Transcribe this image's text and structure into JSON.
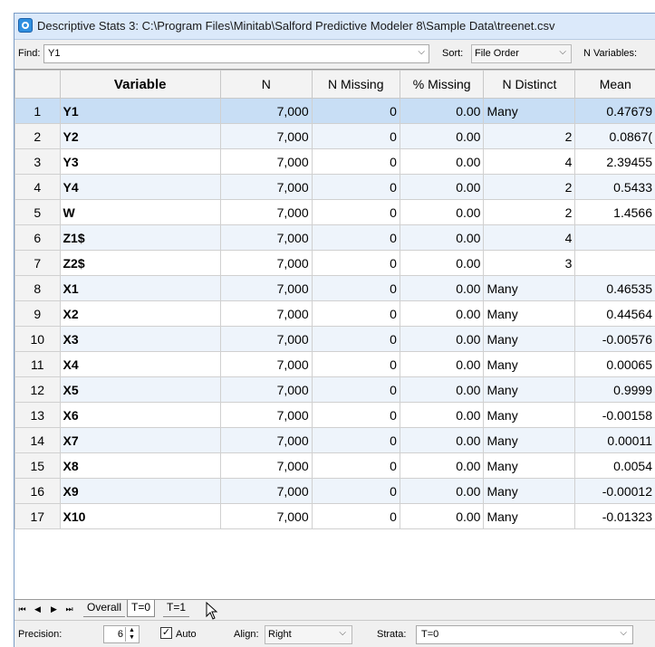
{
  "window": {
    "title": "Descriptive Stats 3: C:\\Program Files\\Minitab\\Salford Predictive Modeler 8\\Sample Data\\treenet.csv"
  },
  "toolbar": {
    "find_label": "Find:",
    "find_value": "Y1",
    "sort_label": "Sort:",
    "sort_value": "File Order",
    "nvars_label": "N Variables:"
  },
  "grid": {
    "columns": [
      "",
      "Variable",
      "N",
      "N Missing",
      "% Missing",
      "N Distinct",
      "Mean"
    ],
    "selected_row": 1,
    "rows": [
      {
        "num": "1",
        "var": "Y1",
        "n": "7,000",
        "nmiss": "0",
        "pmiss": "0.00",
        "ndist": "Many",
        "mean": "0.47679"
      },
      {
        "num": "2",
        "var": "Y2",
        "n": "7,000",
        "nmiss": "0",
        "pmiss": "0.00",
        "ndist": "2",
        "mean": "0.0867("
      },
      {
        "num": "3",
        "var": "Y3",
        "n": "7,000",
        "nmiss": "0",
        "pmiss": "0.00",
        "ndist": "4",
        "mean": "2.39455"
      },
      {
        "num": "4",
        "var": "Y4",
        "n": "7,000",
        "nmiss": "0",
        "pmiss": "0.00",
        "ndist": "2",
        "mean": "0.5433"
      },
      {
        "num": "5",
        "var": "W",
        "n": "7,000",
        "nmiss": "0",
        "pmiss": "0.00",
        "ndist": "2",
        "mean": "1.4566"
      },
      {
        "num": "6",
        "var": "Z1$",
        "n": "7,000",
        "nmiss": "0",
        "pmiss": "0.00",
        "ndist": "4",
        "mean": ""
      },
      {
        "num": "7",
        "var": "Z2$",
        "n": "7,000",
        "nmiss": "0",
        "pmiss": "0.00",
        "ndist": "3",
        "mean": ""
      },
      {
        "num": "8",
        "var": "X1",
        "n": "7,000",
        "nmiss": "0",
        "pmiss": "0.00",
        "ndist": "Many",
        "mean": "0.46535"
      },
      {
        "num": "9",
        "var": "X2",
        "n": "7,000",
        "nmiss": "0",
        "pmiss": "0.00",
        "ndist": "Many",
        "mean": "0.44564"
      },
      {
        "num": "10",
        "var": "X3",
        "n": "7,000",
        "nmiss": "0",
        "pmiss": "0.00",
        "ndist": "Many",
        "mean": "-0.00576"
      },
      {
        "num": "11",
        "var": "X4",
        "n": "7,000",
        "nmiss": "0",
        "pmiss": "0.00",
        "ndist": "Many",
        "mean": "0.00065"
      },
      {
        "num": "12",
        "var": "X5",
        "n": "7,000",
        "nmiss": "0",
        "pmiss": "0.00",
        "ndist": "Many",
        "mean": "0.9999"
      },
      {
        "num": "13",
        "var": "X6",
        "n": "7,000",
        "nmiss": "0",
        "pmiss": "0.00",
        "ndist": "Many",
        "mean": "-0.00158"
      },
      {
        "num": "14",
        "var": "X7",
        "n": "7,000",
        "nmiss": "0",
        "pmiss": "0.00",
        "ndist": "Many",
        "mean": "0.00011"
      },
      {
        "num": "15",
        "var": "X8",
        "n": "7,000",
        "nmiss": "0",
        "pmiss": "0.00",
        "ndist": "Many",
        "mean": "0.0054"
      },
      {
        "num": "16",
        "var": "X9",
        "n": "7,000",
        "nmiss": "0",
        "pmiss": "0.00",
        "ndist": "Many",
        "mean": "-0.00012"
      },
      {
        "num": "17",
        "var": "X10",
        "n": "7,000",
        "nmiss": "0",
        "pmiss": "0.00",
        "ndist": "Many",
        "mean": "-0.01323"
      }
    ]
  },
  "tabs": [
    {
      "label": "Overall",
      "active": false
    },
    {
      "label": "T=0",
      "active": true
    },
    {
      "label": "T=1",
      "active": false
    }
  ],
  "bottom": {
    "precision_label": "Precision:",
    "precision_value": "6",
    "auto_label": "Auto",
    "auto_checked": true,
    "align_label": "Align:",
    "align_value": "Right",
    "strata_label": "Strata:",
    "strata_value": "T=0"
  },
  "colors": {
    "titlebar": "#dbe9fa",
    "selected_row": "#c8def5",
    "alt_row": "#eef4fb"
  }
}
